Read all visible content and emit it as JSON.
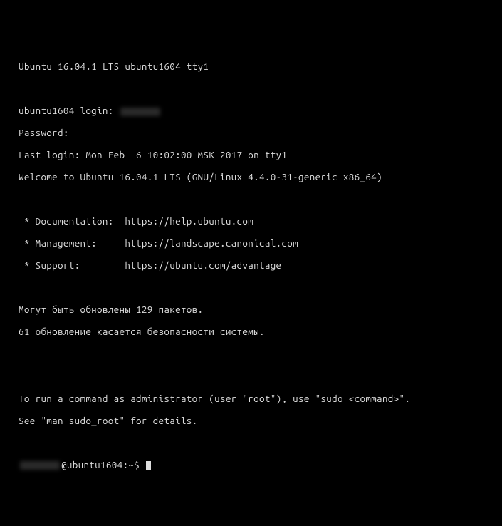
{
  "header": "Ubuntu 16.04.1 LTS ubuntu1604 tty1",
  "login_prompt": "ubuntu1604 login: ",
  "password_prompt": "Password:",
  "last_login": "Last login: Mon Feb  6 10:02:00 MSK 2017 on tty1",
  "welcome": "Welcome to Ubuntu 16.04.1 LTS (GNU/Linux 4.4.0-31-generic x86_64)",
  "docs_line": " * Documentation:  https://help.ubuntu.com",
  "mgmt_line": " * Management:     https://landscape.canonical.com",
  "support_line": " * Support:        https://ubuntu.com/advantage",
  "updates_line1": "Могут быть обновлены 129 пакетов.",
  "updates_line2": "61 обновление касается безопасности системы.",
  "sudo_line1": "To run a command as administrator (user \"root\"), use \"sudo <command>\".",
  "sudo_line2": "See \"man sudo_root\" for details.",
  "prompt_suffix": "@ubuntu1604:~$ "
}
